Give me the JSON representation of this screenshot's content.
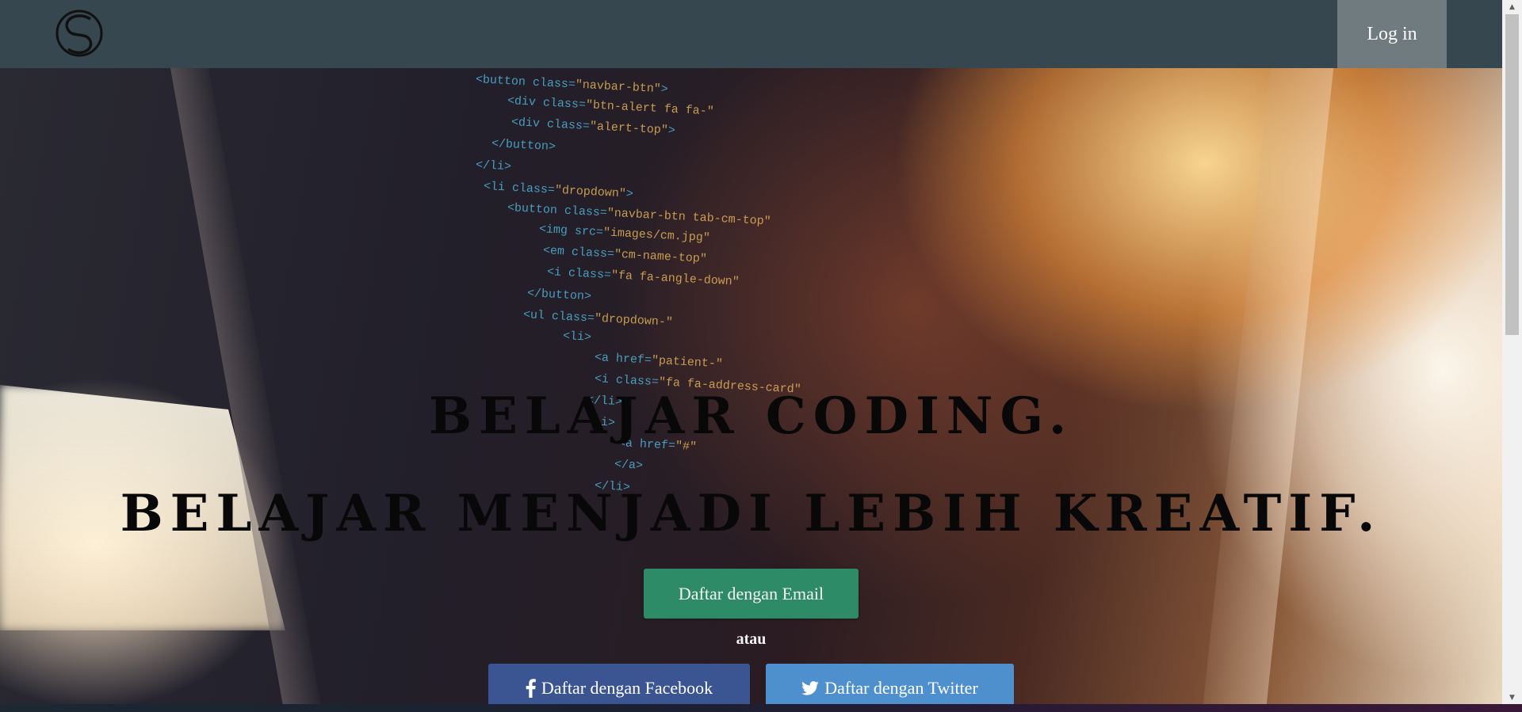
{
  "nav": {
    "logo_icon": "s-circle-logo-icon",
    "login_label": "Log in"
  },
  "hero": {
    "headline_1": "BELAJAR CODING.",
    "headline_2": "BELAJAR MENJADI LEBIH KREATIF.",
    "email_button": "Daftar dengan Email",
    "separator": "atau",
    "facebook_button": "Daftar dengan Facebook",
    "facebook_icon": "facebook-icon",
    "twitter_button": "Daftar dengan Twitter",
    "twitter_icon": "twitter-icon",
    "background_code": [
      {
        "tag": "<button class=",
        "val": "\"navbar-btn\"",
        "end": ">"
      },
      {
        "tag": "<div class=",
        "val": "\"btn-alert fa fa-\"",
        "end": ""
      },
      {
        "tag": "<div class=",
        "val": "\"alert-top\"",
        "end": ">"
      },
      {
        "tag": "</button>",
        "val": "",
        "end": ""
      },
      {
        "tag": "</li>",
        "val": "",
        "end": ""
      },
      {
        "tag": "<li class=",
        "val": "\"dropdown\"",
        "end": ">"
      },
      {
        "tag": "<button class=",
        "val": "\"navbar-btn tab-cm-top\"",
        "end": ""
      },
      {
        "tag": "<img src=",
        "val": "\"images/cm.jpg\"",
        "end": ""
      },
      {
        "tag": "<em class=",
        "val": "\"cm-name-top\"",
        "end": ""
      },
      {
        "tag": "<i class=",
        "val": "\"fa fa-angle-down\"",
        "end": ""
      },
      {
        "tag": "</button>",
        "val": "",
        "end": ""
      },
      {
        "tag": "<ul class=",
        "val": "\"dropdown-\"",
        "end": ""
      },
      {
        "tag": "<li>",
        "val": "",
        "end": ""
      },
      {
        "tag": "<a href=",
        "val": "\"patient-\"",
        "end": ""
      },
      {
        "tag": "<i class=",
        "val": "\"fa fa-address-card\"",
        "end": ""
      },
      {
        "tag": "</li>",
        "val": "",
        "end": ""
      },
      {
        "tag": "<li>",
        "val": "",
        "end": ""
      },
      {
        "tag": "<a href=",
        "val": "\"#\"",
        "end": ""
      },
      {
        "tag": "</a>",
        "val": "",
        "end": ""
      },
      {
        "tag": "</li>",
        "val": "",
        "end": ""
      }
    ]
  },
  "colors": {
    "navbar": "#37474f",
    "login": "#707b80",
    "email_button": "#2e8b68",
    "facebook_button": "#3a5592",
    "twitter_button": "#4e90cd"
  }
}
